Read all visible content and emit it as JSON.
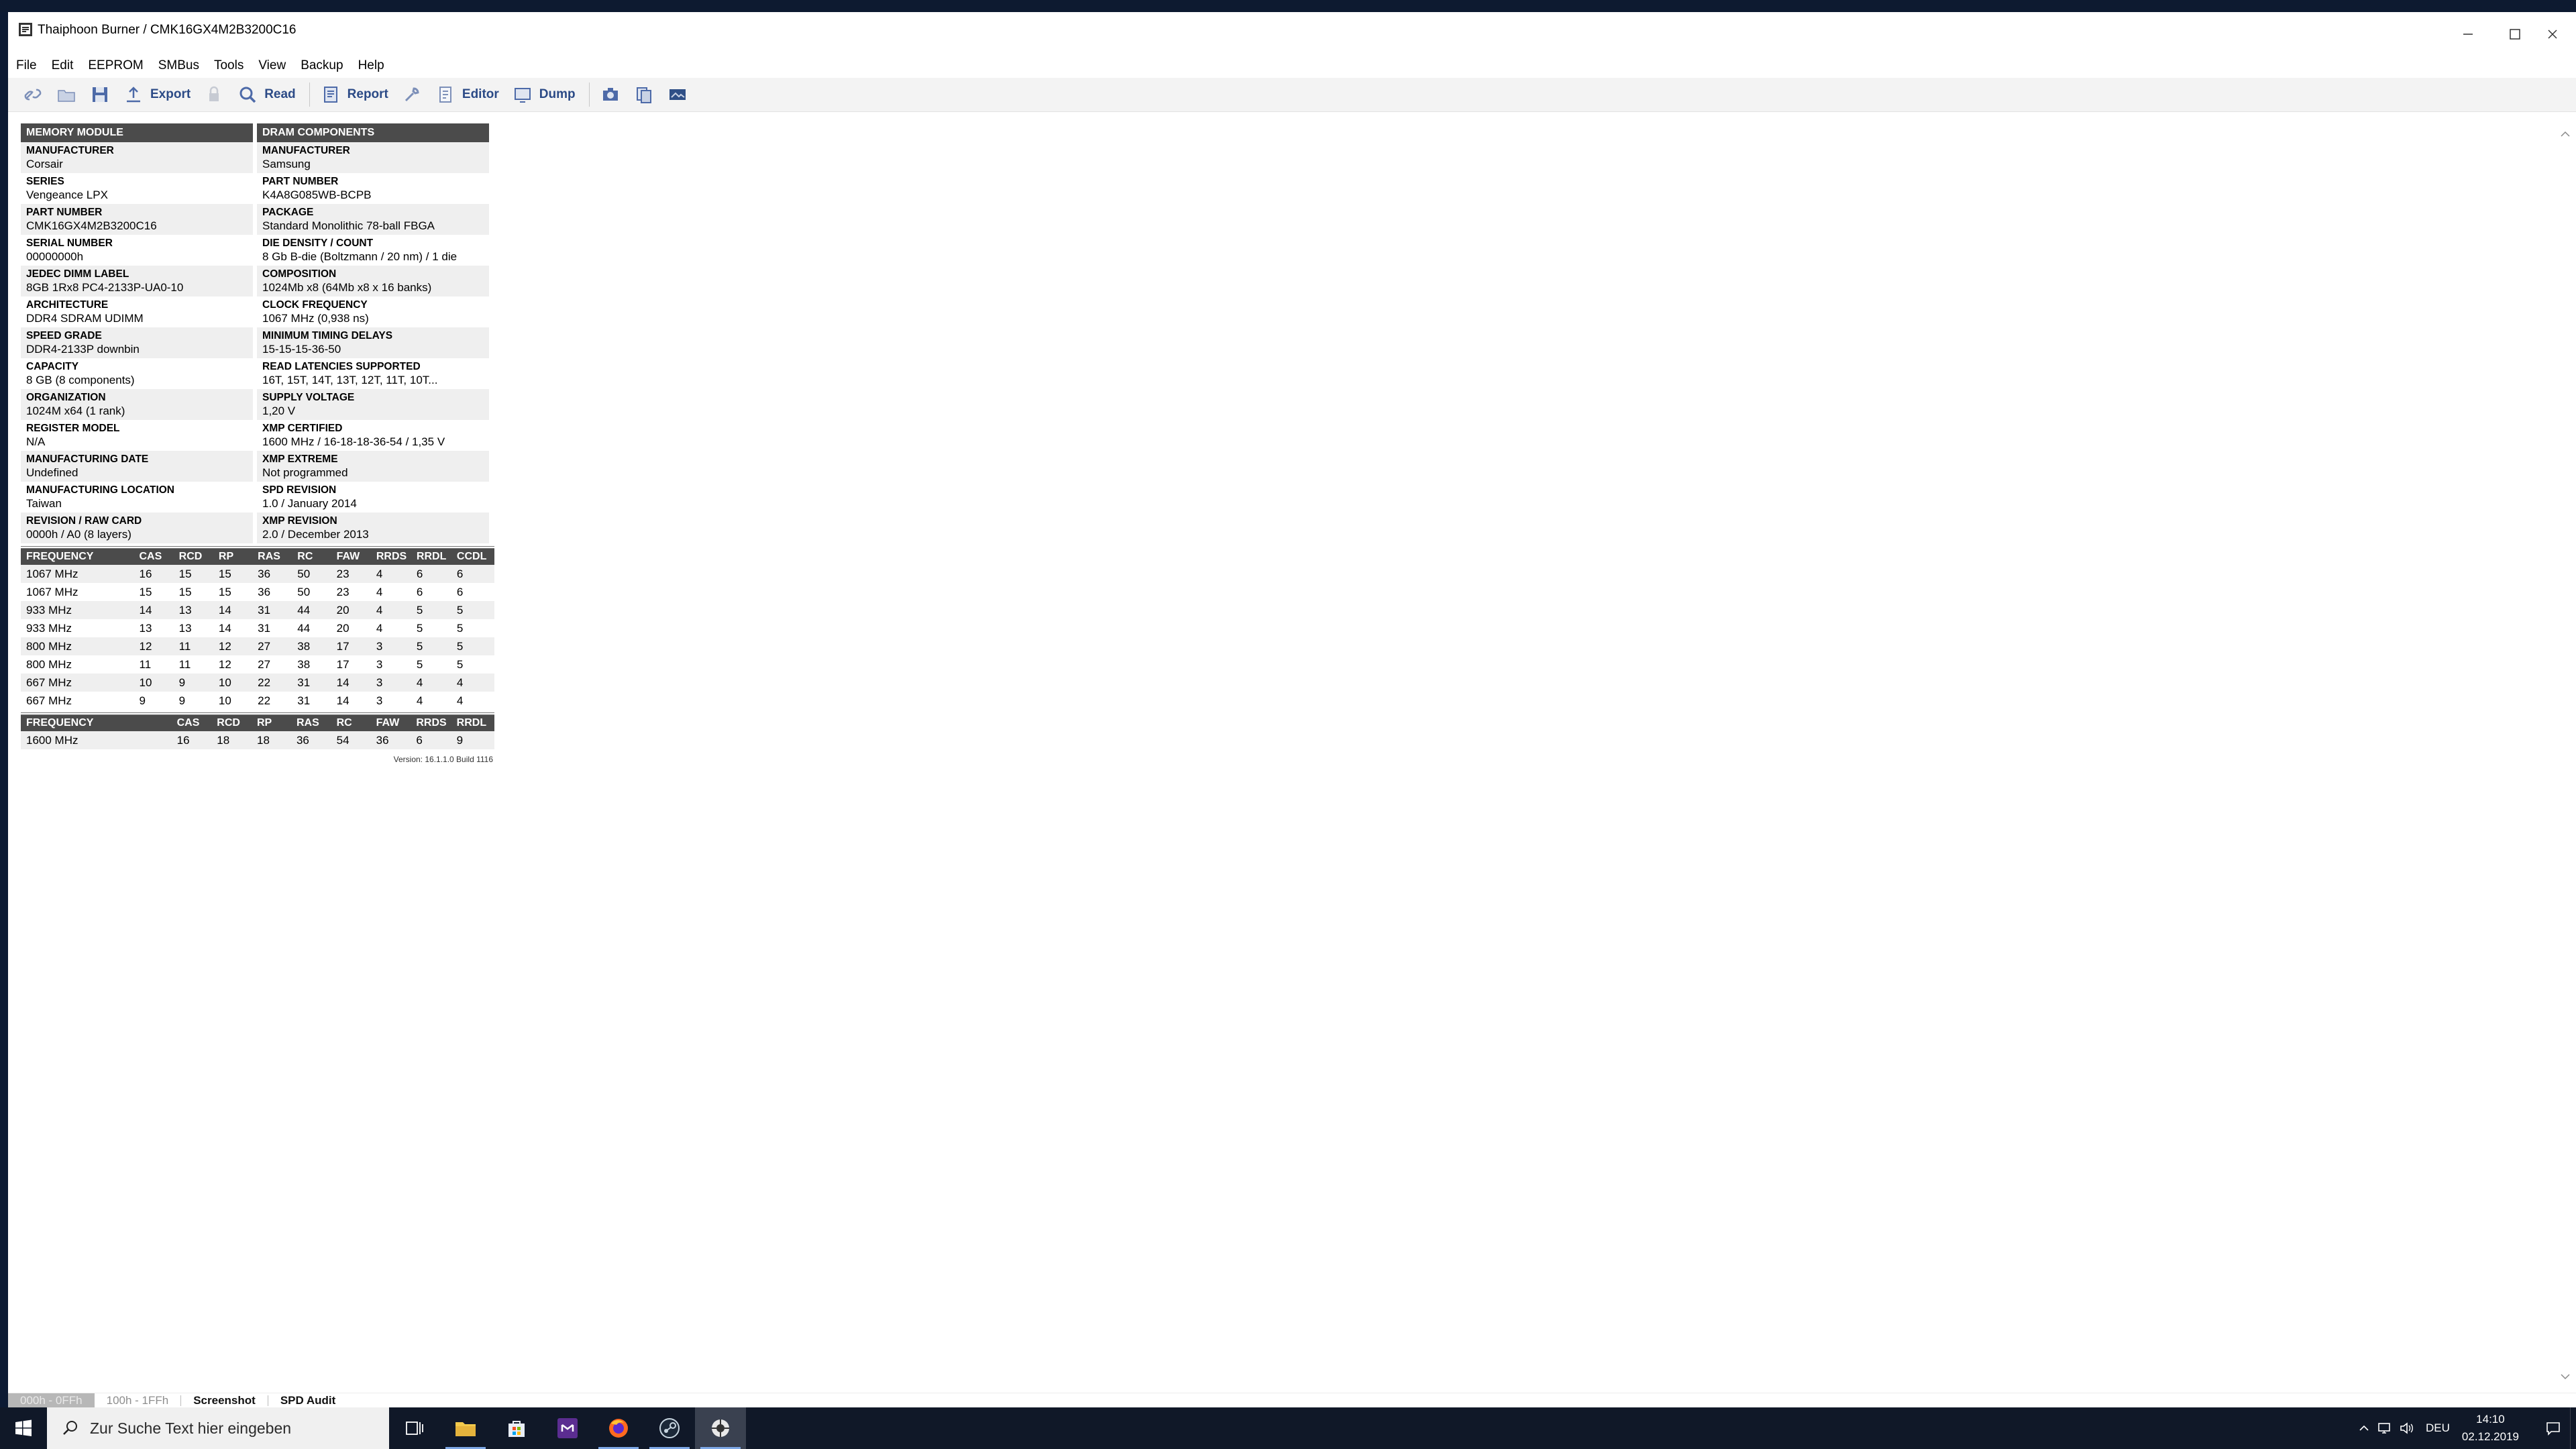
{
  "window": {
    "title": "Thaiphoon Burner / CMK16GX4M2B3200C16"
  },
  "menu": [
    "File",
    "Edit",
    "EEPROM",
    "SMBus",
    "Tools",
    "View",
    "Backup",
    "Help"
  ],
  "toolbar": {
    "export_label": "Export",
    "read_label": "Read",
    "report_label": "Report",
    "editor_label": "Editor",
    "dump_label": "Dump"
  },
  "module": {
    "header": "MEMORY MODULE",
    "fields": [
      {
        "label": "MANUFACTURER",
        "value": "Corsair"
      },
      {
        "label": "SERIES",
        "value": "Vengeance LPX"
      },
      {
        "label": "PART NUMBER",
        "value": "CMK16GX4M2B3200C16"
      },
      {
        "label": "SERIAL NUMBER",
        "value": "00000000h"
      },
      {
        "label": "JEDEC DIMM LABEL",
        "value": "8GB 1Rx8 PC4-2133P-UA0-10"
      },
      {
        "label": "ARCHITECTURE",
        "value": "DDR4 SDRAM UDIMM"
      },
      {
        "label": "SPEED GRADE",
        "value": "DDR4-2133P downbin"
      },
      {
        "label": "CAPACITY",
        "value": "8 GB (8 components)"
      },
      {
        "label": "ORGANIZATION",
        "value": "1024M x64 (1 rank)"
      },
      {
        "label": "REGISTER MODEL",
        "value": "N/A"
      },
      {
        "label": "MANUFACTURING DATE",
        "value": "Undefined"
      },
      {
        "label": "MANUFACTURING LOCATION",
        "value": "Taiwan"
      },
      {
        "label": "REVISION / RAW CARD",
        "value": "0000h / A0 (8 layers)"
      }
    ]
  },
  "dram": {
    "header": "DRAM COMPONENTS",
    "fields": [
      {
        "label": "MANUFACTURER",
        "value": "Samsung"
      },
      {
        "label": "PART NUMBER",
        "value": "K4A8G085WB-BCPB"
      },
      {
        "label": "PACKAGE",
        "value": "Standard Monolithic 78-ball FBGA"
      },
      {
        "label": "DIE DENSITY / COUNT",
        "value": "8 Gb B-die (Boltzmann / 20 nm) / 1 die"
      },
      {
        "label": "COMPOSITION",
        "value": "1024Mb x8 (64Mb x8 x 16 banks)"
      },
      {
        "label": "CLOCK FREQUENCY",
        "value": "1067 MHz (0,938 ns)"
      },
      {
        "label": "MINIMUM TIMING DELAYS",
        "value": "15-15-15-36-50"
      },
      {
        "label": "READ LATENCIES SUPPORTED",
        "value": "16T, 15T, 14T, 13T, 12T, 11T, 10T..."
      },
      {
        "label": "SUPPLY VOLTAGE",
        "value": "1,20 V"
      },
      {
        "label": "XMP CERTIFIED",
        "value": "1600 MHz / 16-18-18-36-54 / 1,35 V"
      },
      {
        "label": "XMP EXTREME",
        "value": "Not programmed"
      },
      {
        "label": "SPD REVISION",
        "value": "1.0 / January 2014"
      },
      {
        "label": "XMP REVISION",
        "value": "2.0 / December 2013"
      }
    ]
  },
  "jedec_timings": {
    "headers": [
      "FREQUENCY",
      "CAS",
      "RCD",
      "RP",
      "RAS",
      "RC",
      "FAW",
      "RRDS",
      "RRDL",
      "CCDL"
    ],
    "rows": [
      [
        "1067 MHz",
        "16",
        "15",
        "15",
        "36",
        "50",
        "23",
        "4",
        "6",
        "6"
      ],
      [
        "1067 MHz",
        "15",
        "15",
        "15",
        "36",
        "50",
        "23",
        "4",
        "6",
        "6"
      ],
      [
        "933 MHz",
        "14",
        "13",
        "14",
        "31",
        "44",
        "20",
        "4",
        "5",
        "5"
      ],
      [
        "933 MHz",
        "13",
        "13",
        "14",
        "31",
        "44",
        "20",
        "4",
        "5",
        "5"
      ],
      [
        "800 MHz",
        "12",
        "11",
        "12",
        "27",
        "38",
        "17",
        "3",
        "5",
        "5"
      ],
      [
        "800 MHz",
        "11",
        "11",
        "12",
        "27",
        "38",
        "17",
        "3",
        "5",
        "5"
      ],
      [
        "667 MHz",
        "10",
        "9",
        "10",
        "22",
        "31",
        "14",
        "3",
        "4",
        "4"
      ],
      [
        "667 MHz",
        "9",
        "9",
        "10",
        "22",
        "31",
        "14",
        "3",
        "4",
        "4"
      ]
    ]
  },
  "xmp_timings": {
    "headers": [
      "FREQUENCY",
      "CAS",
      "RCD",
      "RP",
      "RAS",
      "RC",
      "FAW",
      "RRDS",
      "RRDL"
    ],
    "rows": [
      [
        "1600 MHz",
        "16",
        "18",
        "18",
        "36",
        "54",
        "36",
        "6",
        "9"
      ]
    ]
  },
  "version": "Version: 16.1.1.0 Build 1116",
  "tabs": [
    "000h - 0FFh",
    "100h - 1FFh",
    "Screenshot",
    "SPD Audit"
  ],
  "taskbar": {
    "search_placeholder": "Zur Suche Text hier eingeben",
    "language": "DEU",
    "time": "14:10",
    "date": "02.12.2019"
  }
}
